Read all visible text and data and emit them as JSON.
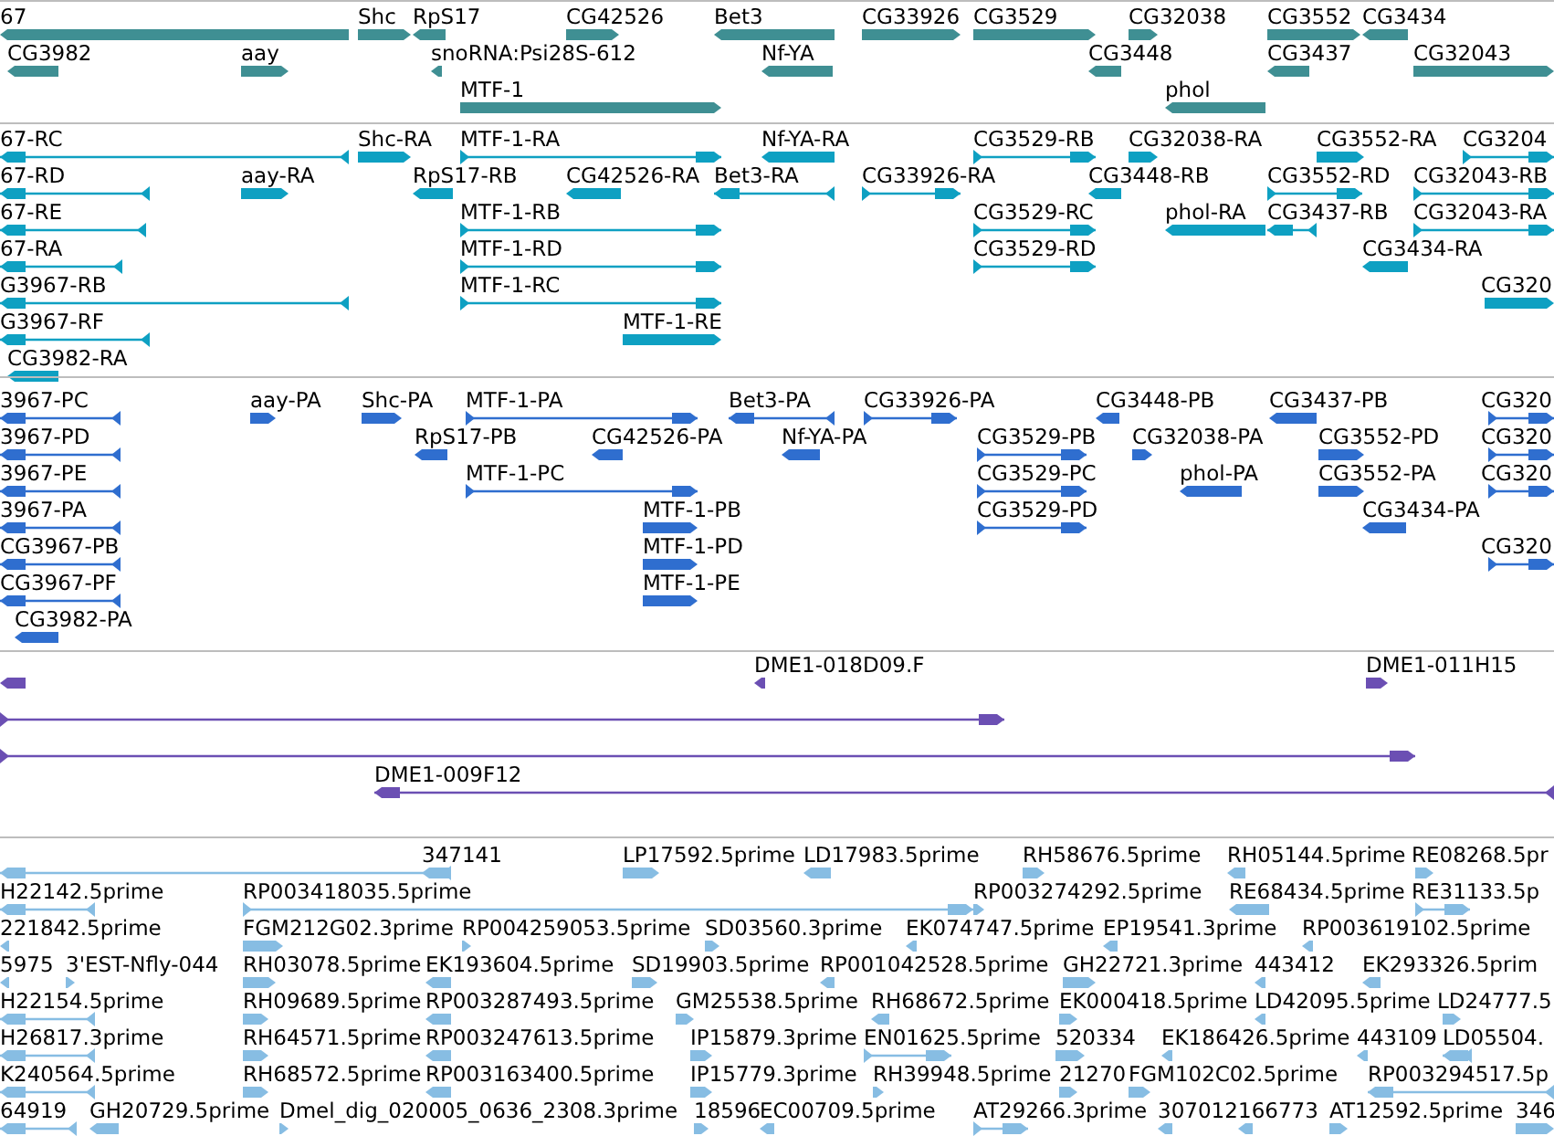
{
  "tracks": [
    {
      "kind": "gene",
      "features": [
        {
          "label": "67",
          "reverse": true
        },
        {
          "label": "Shc",
          "reverse": false
        },
        {
          "label": "RpS17",
          "reverse": true
        },
        {
          "label": "CG42526",
          "reverse": false
        },
        {
          "label": "Bet3",
          "reverse": true
        },
        {
          "label": "CG33926",
          "reverse": false
        },
        {
          "label": "CG3529",
          "reverse": false
        },
        {
          "label": "CG32038",
          "reverse": false
        },
        {
          "label": "CG3552",
          "reverse": false
        },
        {
          "label": "CG3434",
          "reverse": true
        },
        {
          "label": "CG3982",
          "reverse": true
        },
        {
          "label": "aay",
          "reverse": false
        },
        {
          "label": "snoRNA:Psi28S-612",
          "reverse": true
        },
        {
          "label": "Nf-YA",
          "reverse": true
        },
        {
          "label": "CG3448",
          "reverse": true
        },
        {
          "label": "CG3437",
          "reverse": true
        },
        {
          "label": "CG32043",
          "reverse": false
        },
        {
          "label": "MTF-1",
          "reverse": false
        },
        {
          "label": "phol",
          "reverse": true
        }
      ]
    },
    {
      "kind": "transcript",
      "features": [
        {
          "label": "67-RC",
          "reverse": true
        },
        {
          "label": "Shc-RA",
          "reverse": false
        },
        {
          "label": "MTF-1-RA",
          "reverse": false
        },
        {
          "label": "Nf-YA-RA",
          "reverse": true
        },
        {
          "label": "CG3529-RB",
          "reverse": false
        },
        {
          "label": "CG32038-RA",
          "reverse": false
        },
        {
          "label": "CG3552-RA",
          "reverse": false
        },
        {
          "label": "CG3204",
          "reverse": false
        },
        {
          "label": "67-RD",
          "reverse": true
        },
        {
          "label": "aay-RA",
          "reverse": false
        },
        {
          "label": "RpS17-RB",
          "reverse": true
        },
        {
          "label": "CG42526-RA",
          "reverse": true
        },
        {
          "label": "Bet3-RA",
          "reverse": true
        },
        {
          "label": "CG33926-RA",
          "reverse": false
        },
        {
          "label": "CG3448-RB",
          "reverse": true
        },
        {
          "label": "CG3552-RD",
          "reverse": false
        },
        {
          "label": "CG32043-RB",
          "reverse": false
        },
        {
          "label": "67-RE",
          "reverse": true
        },
        {
          "label": "MTF-1-RB",
          "reverse": false
        },
        {
          "label": "CG3529-RC",
          "reverse": false
        },
        {
          "label": "phol-RA",
          "reverse": true
        },
        {
          "label": "CG3437-RB",
          "reverse": true
        },
        {
          "label": "CG32043-RA",
          "reverse": false
        },
        {
          "label": "67-RA",
          "reverse": true
        },
        {
          "label": "MTF-1-RD",
          "reverse": false
        },
        {
          "label": "CG3529-RD",
          "reverse": false
        },
        {
          "label": "CG3434-RA",
          "reverse": true
        },
        {
          "label": "G3967-RB",
          "reverse": true
        },
        {
          "label": "MTF-1-RC",
          "reverse": false
        },
        {
          "label": "CG320",
          "reverse": false
        },
        {
          "label": "G3967-RF",
          "reverse": true
        },
        {
          "label": "MTF-1-RE",
          "reverse": false
        },
        {
          "label": "CG3982-RA",
          "reverse": true
        }
      ]
    },
    {
      "kind": "protein",
      "features": [
        {
          "label": "3967-PC",
          "reverse": true
        },
        {
          "label": "aay-PA",
          "reverse": false
        },
        {
          "label": "Shc-PA",
          "reverse": false
        },
        {
          "label": "MTF-1-PA",
          "reverse": false
        },
        {
          "label": "Bet3-PA",
          "reverse": true
        },
        {
          "label": "CG33926-PA",
          "reverse": false
        },
        {
          "label": "CG3448-PB",
          "reverse": true
        },
        {
          "label": "CG3437-PB",
          "reverse": true
        },
        {
          "label": "CG320",
          "reverse": false
        },
        {
          "label": "3967-PD",
          "reverse": true
        },
        {
          "label": "RpS17-PB",
          "reverse": true
        },
        {
          "label": "CG42526-PA",
          "reverse": true
        },
        {
          "label": "Nf-YA-PA",
          "reverse": true
        },
        {
          "label": "CG3529-PB",
          "reverse": false
        },
        {
          "label": "CG32038-PA",
          "reverse": false
        },
        {
          "label": "CG3552-PD",
          "reverse": false
        },
        {
          "label": "CG320",
          "reverse": false
        },
        {
          "label": "3967-PE",
          "reverse": true
        },
        {
          "label": "MTF-1-PC",
          "reverse": false
        },
        {
          "label": "CG3529-PC",
          "reverse": false
        },
        {
          "label": "phol-PA",
          "reverse": true
        },
        {
          "label": "CG3552-PA",
          "reverse": false
        },
        {
          "label": "CG320",
          "reverse": false
        },
        {
          "label": "3967-PA",
          "reverse": true
        },
        {
          "label": "MTF-1-PB",
          "reverse": false
        },
        {
          "label": "CG3529-PD",
          "reverse": false
        },
        {
          "label": "CG3434-PA",
          "reverse": true
        },
        {
          "label": "CG3967-PB",
          "reverse": true
        },
        {
          "label": "MTF-1-PD",
          "reverse": false
        },
        {
          "label": "CG320",
          "reverse": false
        },
        {
          "label": "CG3967-PF",
          "reverse": true
        },
        {
          "label": "MTF-1-PE",
          "reverse": false
        },
        {
          "label": "CG3982-PA",
          "reverse": true
        }
      ]
    },
    {
      "kind": "clone",
      "features": [
        {
          "reverse": true
        },
        {
          "label": "DME1-018D09.F",
          "reverse": true
        },
        {
          "label": "DME1-011H15",
          "reverse": false
        },
        {
          "reverse": false
        },
        {
          "reverse": false
        },
        {
          "label": "DME1-009F12",
          "reverse": true
        }
      ]
    },
    {
      "kind": "read",
      "features": [
        {
          "reverse": true
        },
        {
          "label": "347141",
          "reverse": true
        },
        {
          "label": "LP17592.5prime",
          "reverse": false
        },
        {
          "label": "LD17983.5prime",
          "reverse": true
        },
        {
          "label": "RH58676.5prime",
          "reverse": false
        },
        {
          "label": "RH05144.5prime",
          "reverse": true
        },
        {
          "label": "RE08268.5pr",
          "reverse": false
        },
        {
          "label": "H22142.5prime",
          "reverse": true
        },
        {
          "label": "RP003418035.5prime",
          "reverse": false
        },
        {
          "label": "RP003274292.5prime",
          "reverse": false
        },
        {
          "label": "RE68434.5prime",
          "reverse": true
        },
        {
          "label": "RE31133.5p",
          "reverse": false
        },
        {
          "label": "221842.5prime",
          "reverse": true
        },
        {
          "label": "FGM212G02.3prime",
          "reverse": false
        },
        {
          "label": "RP004259053.5prime",
          "reverse": false
        },
        {
          "label": "SD03560.3prime",
          "reverse": false
        },
        {
          "label": "EK074747.5prime",
          "reverse": true
        },
        {
          "label": "EP19541.3prime",
          "reverse": true
        },
        {
          "label": "RP003619102.5prime",
          "reverse": true
        },
        {
          "label": "5975",
          "reverse": true
        },
        {
          "label": "3'EST-Nfly-044",
          "reverse": false
        },
        {
          "label": "RH03078.5prime",
          "reverse": false
        },
        {
          "label": "EK193604.5prime",
          "reverse": true
        },
        {
          "label": "SD19903.5prime",
          "reverse": false
        },
        {
          "label": "RP001042528.5prime",
          "reverse": true
        },
        {
          "label": "GH22721.3prime",
          "reverse": false
        },
        {
          "label": "443412",
          "reverse": true
        },
        {
          "label": "EK293326.5prim",
          "reverse": true
        },
        {
          "label": "H22154.5prime",
          "reverse": true
        },
        {
          "label": "RH09689.5prime",
          "reverse": false
        },
        {
          "label": "RP003287493.5prime",
          "reverse": true
        },
        {
          "label": "GM25538.5prime",
          "reverse": false
        },
        {
          "label": "RH68672.5prime",
          "reverse": true
        },
        {
          "label": "EK000418.5prime",
          "reverse": false
        },
        {
          "label": "LD42095.5prime",
          "reverse": true
        },
        {
          "label": "LD24777.5",
          "reverse": false
        },
        {
          "label": "H26817.3prime",
          "reverse": true
        },
        {
          "label": "RH64571.5prime",
          "reverse": false
        },
        {
          "label": "RP003247613.5prime",
          "reverse": true
        },
        {
          "label": "IP15879.3prime",
          "reverse": false
        },
        {
          "label": "EN01625.5prime",
          "reverse": false
        },
        {
          "label": "520334",
          "reverse": false
        },
        {
          "label": "EK186426.5prime",
          "reverse": true
        },
        {
          "label": "443109",
          "reverse": true
        },
        {
          "label": "LD05504.",
          "reverse": true
        },
        {
          "label": "K240564.5prime",
          "reverse": true
        },
        {
          "label": "RH68572.5prime",
          "reverse": false
        },
        {
          "label": "RP003163400.5prime",
          "reverse": true
        },
        {
          "label": "IP15779.3prime",
          "reverse": false
        },
        {
          "label": "RH39948.5prime",
          "reverse": false
        },
        {
          "label": "21270",
          "reverse": false
        },
        {
          "label": "FGM102C02.5prime",
          "reverse": false
        },
        {
          "label": "RP003294517.5p",
          "reverse": true
        },
        {
          "label": "64919",
          "reverse": true
        },
        {
          "label": "GH20729.5prime",
          "reverse": true
        },
        {
          "label": "Dmel_dig_020005_0636_2308.3prime",
          "reverse": false
        },
        {
          "label": "18596",
          "reverse": false
        },
        {
          "label": "EC00709.5prime",
          "reverse": true
        },
        {
          "label": "AT29266.3prime",
          "reverse": false
        },
        {
          "label": "307012",
          "reverse": true
        },
        {
          "label": "166773",
          "reverse": true
        },
        {
          "label": "AT12592.5prime",
          "reverse": false
        },
        {
          "label": "346",
          "reverse": false
        }
      ]
    }
  ]
}
